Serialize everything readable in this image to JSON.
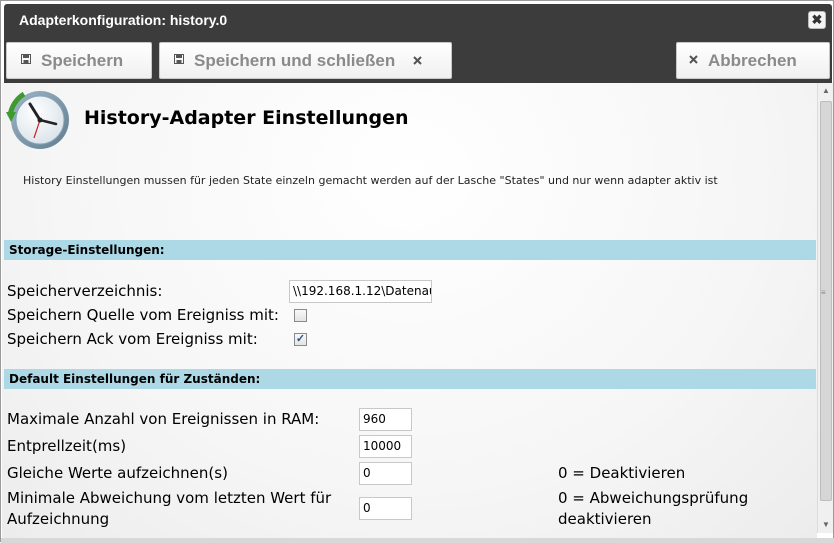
{
  "window": {
    "title": "Adapterkonfiguration: history.0",
    "close_glyph": "✖"
  },
  "toolbar": {
    "save_label": "Speichern",
    "save_close_label": "Speichern und schließen",
    "cancel_label": "Abbrechen"
  },
  "page": {
    "heading": "History-Adapter Einstellungen",
    "info": "History Einstellungen mussen für jeden State einzeln gemacht werden auf der Lasche \"States\" und nur wenn adapter aktiv ist"
  },
  "storage": {
    "section_title": "Storage-Einstellungen:",
    "directory_label": "Speicherverzeichnis:",
    "directory_value": "\\\\192.168.1.12\\Datenau",
    "source_label": "Speichern Quelle vom Ereigniss mit:",
    "source_checked": false,
    "ack_label": "Speichern Ack vom Ereigniss mit:",
    "ack_checked": true,
    "check_glyph": "✓"
  },
  "defaults": {
    "section_title": "Default Einstellungen für Zuständen:",
    "max_events_label": "Maximale Anzahl von Ereignissen in RAM:",
    "max_events_value": "960",
    "debounce_label": "Entprellzeit(ms)",
    "debounce_value": "10000",
    "same_values_label": "Gleiche Werte aufzeichnen(s)",
    "same_values_value": "0",
    "same_values_hint": "0 = Deaktivieren",
    "min_deviation_label_line1": "Minimale Abweichung vom letzten Wert für",
    "min_deviation_label_line2": "Aufzeichnung",
    "min_deviation_value": "0",
    "min_deviation_hint_line1": "0 = Abweichungsprüfung",
    "min_deviation_hint_line2": "deaktivieren"
  },
  "colors": {
    "titlebar": "#3c3c3c",
    "section_bar": "#add8e6",
    "button_text": "#8a8a8a"
  },
  "icons": {
    "logo": "history-clock-icon",
    "save": "floppy-disk-icon",
    "save_close": "floppy-disk-icon",
    "cancel": "close-icon",
    "window_close": "close-icon"
  }
}
